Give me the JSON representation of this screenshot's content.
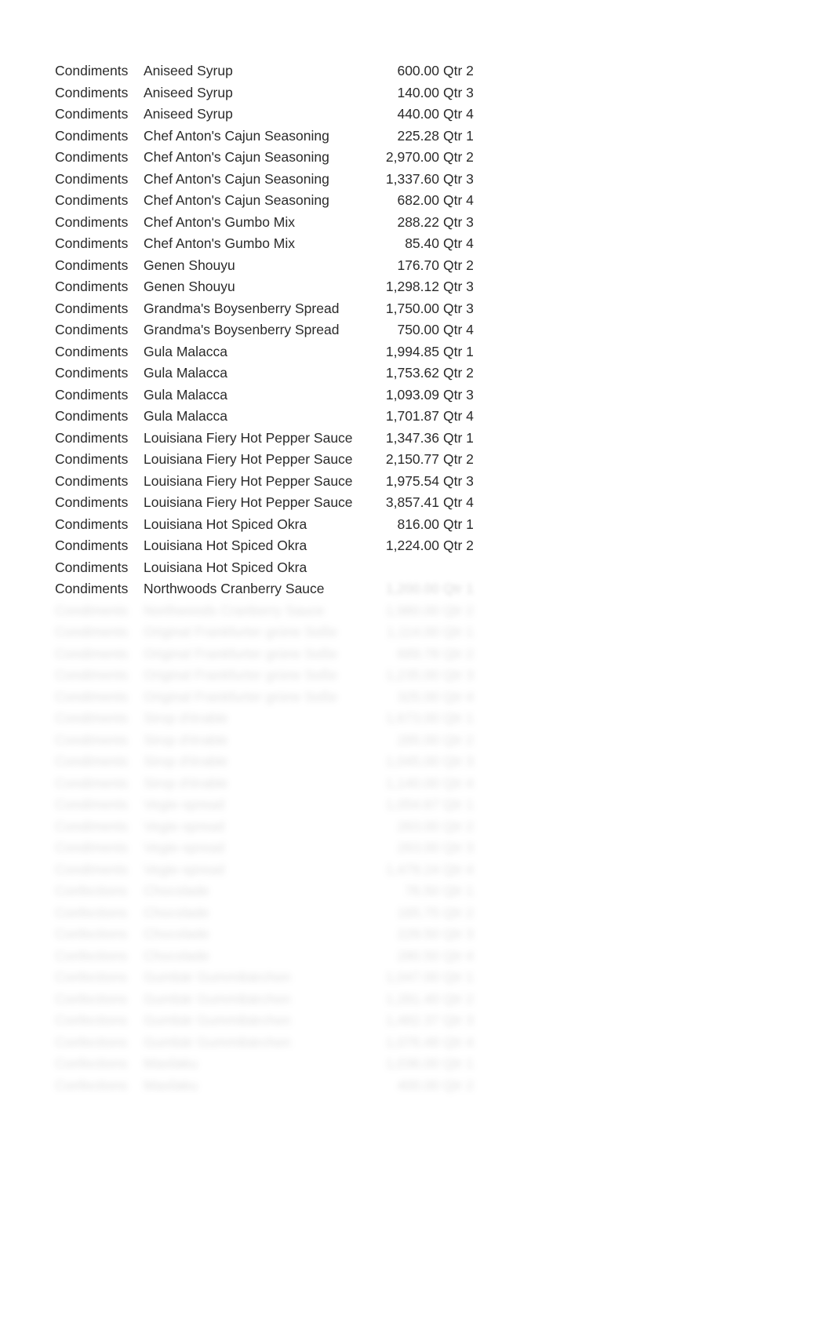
{
  "rows": [
    {
      "category": "Condiments",
      "product": "Aniseed Syrup",
      "amount": "600.00",
      "qtr": "Qtr 2"
    },
    {
      "category": "Condiments",
      "product": "Aniseed Syrup",
      "amount": "140.00",
      "qtr": "Qtr 3"
    },
    {
      "category": "Condiments",
      "product": "Aniseed Syrup",
      "amount": "440.00",
      "qtr": "Qtr 4"
    },
    {
      "category": "Condiments",
      "product": "Chef Anton's Cajun Seasoning",
      "amount": "225.28",
      "qtr": "Qtr 1"
    },
    {
      "category": "Condiments",
      "product": "Chef Anton's Cajun Seasoning",
      "amount": "2,970.00",
      "qtr": "Qtr 2"
    },
    {
      "category": "Condiments",
      "product": "Chef Anton's Cajun Seasoning",
      "amount": "1,337.60",
      "qtr": "Qtr 3"
    },
    {
      "category": "Condiments",
      "product": "Chef Anton's Cajun Seasoning",
      "amount": "682.00",
      "qtr": "Qtr 4"
    },
    {
      "category": "Condiments",
      "product": "Chef Anton's Gumbo Mix",
      "amount": "288.22",
      "qtr": "Qtr 3"
    },
    {
      "category": "Condiments",
      "product": "Chef Anton's Gumbo Mix",
      "amount": "85.40",
      "qtr": "Qtr 4"
    },
    {
      "category": "Condiments",
      "product": "Genen Shouyu",
      "amount": "176.70",
      "qtr": "Qtr 2"
    },
    {
      "category": "Condiments",
      "product": "Genen Shouyu",
      "amount": "1,298.12",
      "qtr": "Qtr 3"
    },
    {
      "category": "Condiments",
      "product": "Grandma's Boysenberry Spread",
      "amount": "1,750.00",
      "qtr": "Qtr 3"
    },
    {
      "category": "Condiments",
      "product": "Grandma's Boysenberry Spread",
      "amount": "750.00",
      "qtr": "Qtr 4"
    },
    {
      "category": "Condiments",
      "product": "Gula Malacca",
      "amount": "1,994.85",
      "qtr": "Qtr 1"
    },
    {
      "category": "Condiments",
      "product": "Gula Malacca",
      "amount": "1,753.62",
      "qtr": "Qtr 2"
    },
    {
      "category": "Condiments",
      "product": "Gula Malacca",
      "amount": "1,093.09",
      "qtr": "Qtr 3"
    },
    {
      "category": "Condiments",
      "product": "Gula Malacca",
      "amount": "1,701.87",
      "qtr": "Qtr 4"
    },
    {
      "category": "Condiments",
      "product": "Louisiana Fiery Hot Pepper Sauce",
      "amount": "1,347.36",
      "qtr": "Qtr 1"
    },
    {
      "category": "Condiments",
      "product": "Louisiana Fiery Hot Pepper Sauce",
      "amount": "2,150.77",
      "qtr": "Qtr 2"
    },
    {
      "category": "Condiments",
      "product": "Louisiana Fiery Hot Pepper Sauce",
      "amount": "1,975.54",
      "qtr": "Qtr 3"
    },
    {
      "category": "Condiments",
      "product": "Louisiana Fiery Hot Pepper Sauce",
      "amount": "3,857.41",
      "qtr": "Qtr 4"
    },
    {
      "category": "Condiments",
      "product": "Louisiana Hot Spiced Okra",
      "amount": "816.00",
      "qtr": "Qtr 1"
    },
    {
      "category": "Condiments",
      "product": "Louisiana Hot Spiced Okra",
      "amount": "1,224.00",
      "qtr": "Qtr 2"
    }
  ],
  "fade_rows": [
    {
      "category": "Condiments",
      "product": "Louisiana Hot Spiced Okra",
      "amount": "",
      "qtr": ""
    },
    {
      "category": "Condiments",
      "product": "Northwoods Cranberry Sauce",
      "amount": "1,200.00",
      "qtr": "Qtr 1"
    },
    {
      "category": "Condiments",
      "product": "Northwoods Cranberry Sauce",
      "amount": "1,980.00",
      "qtr": "Qtr 2"
    },
    {
      "category": "Condiments",
      "product": "Original Frankfurter grüne Soße",
      "amount": "1,114.00",
      "qtr": "Qtr 1"
    },
    {
      "category": "Condiments",
      "product": "Original Frankfurter grüne Soße",
      "amount": "689.78",
      "qtr": "Qtr 2"
    },
    {
      "category": "Condiments",
      "product": "Original Frankfurter grüne Soße",
      "amount": "1,235.00",
      "qtr": "Qtr 3"
    },
    {
      "category": "Condiments",
      "product": "Original Frankfurter grüne Soße",
      "amount": "325.00",
      "qtr": "Qtr 4"
    },
    {
      "category": "Condiments",
      "product": "Sirop d'érable",
      "amount": "1,673.00",
      "qtr": "Qtr 1"
    },
    {
      "category": "Condiments",
      "product": "Sirop d'érable",
      "amount": "285.00",
      "qtr": "Qtr 2"
    },
    {
      "category": "Condiments",
      "product": "Sirop d'érable",
      "amount": "1,045.00",
      "qtr": "Qtr 3"
    },
    {
      "category": "Condiments",
      "product": "Sirop d'érable",
      "amount": "1,140.00",
      "qtr": "Qtr 4"
    },
    {
      "category": "Condiments",
      "product": "Vegie-spread",
      "amount": "1,054.67",
      "qtr": "Qtr 1"
    },
    {
      "category": "Condiments",
      "product": "Vegie-spread",
      "amount": "263.00",
      "qtr": "Qtr 2"
    },
    {
      "category": "Condiments",
      "product": "Vegie-spread",
      "amount": "263.00",
      "qtr": "Qtr 3"
    },
    {
      "category": "Condiments",
      "product": "Vegie-spread",
      "amount": "1,479.24",
      "qtr": "Qtr 4"
    },
    {
      "category": "Confections",
      "product": "Chocolade",
      "amount": "76.50",
      "qtr": "Qtr 1"
    },
    {
      "category": "Confections",
      "product": "Chocolade",
      "amount": "165.75",
      "qtr": "Qtr 2"
    },
    {
      "category": "Confections",
      "product": "Chocolade",
      "amount": "229.50",
      "qtr": "Qtr 3"
    },
    {
      "category": "Confections",
      "product": "Chocolade",
      "amount": "280.50",
      "qtr": "Qtr 4"
    },
    {
      "category": "Confections",
      "product": "Gumbär Gummibärchen",
      "amount": "1,047.00",
      "qtr": "Qtr 1"
    },
    {
      "category": "Confections",
      "product": "Gumbär Gummibärchen",
      "amount": "1,281.40",
      "qtr": "Qtr 2"
    },
    {
      "category": "Confections",
      "product": "Gumbär Gummibärchen",
      "amount": "1,482.37",
      "qtr": "Qtr 3"
    },
    {
      "category": "Confections",
      "product": "Gumbär Gummibärchen",
      "amount": "1,076.48",
      "qtr": "Qtr 4"
    },
    {
      "category": "Confections",
      "product": "Maxilaku",
      "amount": "1,036.00",
      "qtr": "Qtr 1"
    },
    {
      "category": "Confections",
      "product": "Maxilaku",
      "amount": "400.00",
      "qtr": "Qtr 2"
    }
  ]
}
